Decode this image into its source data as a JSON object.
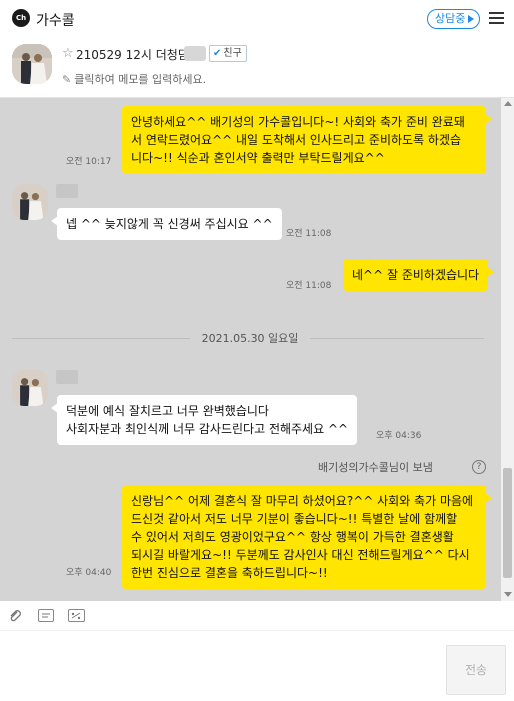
{
  "header": {
    "logo_text": "Ch",
    "title": "가수콜",
    "status_label": "상담중",
    "menu_icon": "hamburger-icon"
  },
  "profile": {
    "star_glyph": "☆",
    "name": "210529 12시 더청담",
    "friend_check": "✔",
    "friend_badge": "친구",
    "memo_placeholder": "클릭하여 메모를 입력하세요."
  },
  "messages": [
    {
      "from": "me",
      "lines": [
        "안녕하세요^^ 배기성의 가수콜입니다~! 사회와 축가 준비 완료돼",
        "서 연락드렸어요^^ 내일 도착해서 인사드리고 준비하도록 하겠습",
        "니다~!! 식순과 혼인서약 출력만 부탁드릴게요^^"
      ],
      "time": "오전 10:17"
    },
    {
      "from": "them",
      "lines": [
        "넵 ^^ 늦지않게 꼭 신경써 주십시요 ^^"
      ],
      "time": "오전 11:08"
    },
    {
      "from": "me",
      "lines": [
        "네^^ 잘 준비하겠습니다"
      ],
      "time": "오전 11:08"
    },
    {
      "from": "them",
      "lines": [
        "덕분에 예식 잘치르고 너무 완벽했습니다",
        "사회자분과 최인식께 너무 감사드린다고 전해주세요 ^^"
      ],
      "time": "오후 04:36"
    },
    {
      "from": "me",
      "lines": [
        "신랑님^^ 어제 결혼식 잘 마무리 하셨어요?^^ 사회와 축가 마음에",
        "드신것 같아서 저도 너무 기분이 좋습니다~!! 특별한 날에 함께할",
        "수 있어서 저희도 영광이었구요^^ 항상 행복이 가득한 결혼생활",
        "되시길 바랄게요~!! 두분께도 감사인사 대신 전해드릴게요^^ 다시",
        "한번 진심으로 결혼을 축하드립니다~!!"
      ],
      "time": "오후 04:40"
    }
  ],
  "date_divider": "2021.05.30 일요일",
  "sent_by_label": "배기성의가수콜님이 보냄",
  "help_glyph": "?",
  "toolbar": {
    "attach_icon": "paperclip-icon",
    "emoticon_icon": "emoticon-icon",
    "capture_icon": "capture-icon"
  },
  "send_label": "전송",
  "colors": {
    "my_bubble": "#ffe500",
    "their_bubble": "#ffffff",
    "chat_background": "#d4d4d4",
    "accent": "#1e88e5"
  }
}
